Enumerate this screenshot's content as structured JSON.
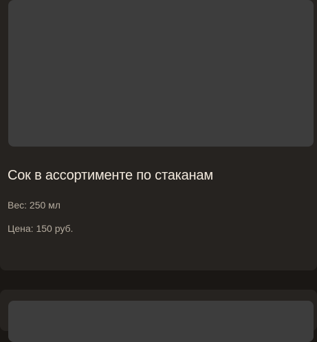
{
  "product": {
    "title": "Сок в ассортименте по стаканам",
    "weight": "Вес: 250 мл",
    "price": "Цена: 150 руб."
  },
  "colors": {
    "background": "#1a1714",
    "card": "#262320",
    "image_placeholder": "#3d3d3d",
    "title_text": "#f2e9dd",
    "meta_text": "#b5ac9f"
  }
}
